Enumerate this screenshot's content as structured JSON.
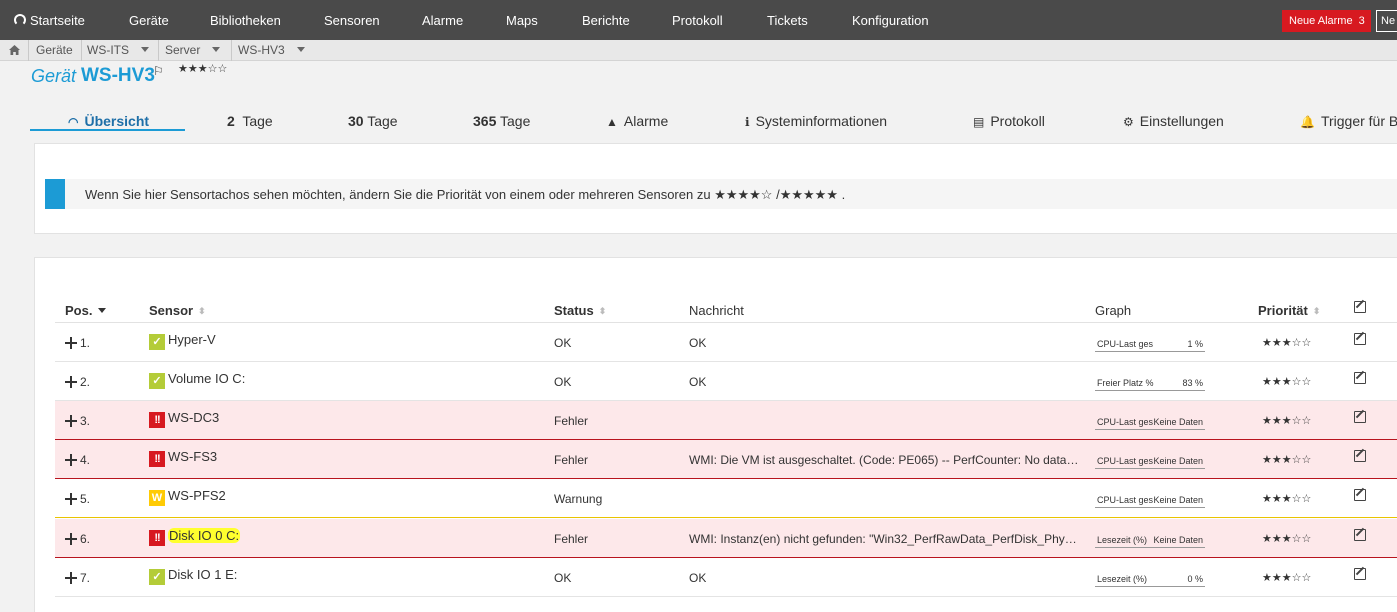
{
  "nav": {
    "home": "Startseite",
    "items": [
      "Geräte",
      "Bibliotheken",
      "Sensoren",
      "Alarme",
      "Maps",
      "Berichte",
      "Protokoll",
      "Tickets",
      "Konfiguration"
    ],
    "alarm_label": "Neue Alarme",
    "alarm_count": "3",
    "next_label": "Ne"
  },
  "breadcrumb": {
    "items": [
      "Geräte",
      "WS-ITS",
      "Server",
      "WS-HV3"
    ]
  },
  "device": {
    "label": "Gerät",
    "name": "WS-HV3",
    "flag": "⚐",
    "stars": "★★★☆☆"
  },
  "tabs": {
    "overview": "Übersicht",
    "t2_num": "2",
    "t2_label": "Tage",
    "t30_num": "30",
    "t30_label": "Tage",
    "t365_num": "365",
    "t365_label": "Tage",
    "alarms": "Alarme",
    "sysinfo": "Systeminformationen",
    "log": "Protokoll",
    "settings": "Einstellungen",
    "trigger": "Trigger für B"
  },
  "info": {
    "text": "Wenn Sie hier Sensortachos sehen möchten, ändern Sie die Priorität von einem oder mehreren Sensoren zu",
    "stars_four": "★★★★☆",
    "separator": "/",
    "stars_five": "★★★★★",
    "end": "."
  },
  "table": {
    "headers": {
      "pos": "Pos.",
      "sensor": "Sensor",
      "status": "Status",
      "message": "Nachricht",
      "graph": "Graph",
      "priority": "Priorität"
    },
    "rows": [
      {
        "pos": "1.",
        "sensor": "Hyper-V",
        "status": "OK",
        "message": "OK",
        "graph_label": "CPU-Last ges",
        "graph_value": "1 %",
        "priority": "★★★☆☆"
      },
      {
        "pos": "2.",
        "sensor": "Volume IO C:",
        "status": "OK",
        "message": "OK",
        "graph_label": "Freier Platz %",
        "graph_value": "83 %",
        "priority": "★★★☆☆"
      },
      {
        "pos": "3.",
        "sensor": "WS-DC3",
        "status": "Fehler",
        "message": "",
        "graph_label": "CPU-Last ges",
        "graph_value": "Keine Daten",
        "priority": "★★★☆☆"
      },
      {
        "pos": "4.",
        "sensor": "WS-FS3",
        "status": "Fehler",
        "message": "WMI: Die VM ist ausgeschaltet. (Code: PE065) -- PerfCounter: No data to ...",
        "graph_label": "CPU-Last ges",
        "graph_value": "Keine Daten",
        "priority": "★★★☆☆"
      },
      {
        "pos": "5.",
        "sensor": "WS-PFS2",
        "status": "Warnung",
        "message": "",
        "graph_label": "CPU-Last ges",
        "graph_value": "Keine Daten",
        "priority": "★★★☆☆"
      },
      {
        "pos": "6.",
        "sensor": "Disk IO 0 C:",
        "status": "Fehler",
        "message": "WMI: Instanz(en) nicht gefunden: \"Win32_PerfRawData_PerfDisk_Physic...",
        "graph_label": "Lesezeit (%)",
        "graph_value": "Keine Daten",
        "priority": "★★★☆☆"
      },
      {
        "pos": "7.",
        "sensor": "Disk IO 1 E:",
        "status": "OK",
        "message": "OK",
        "graph_label": "Lesezeit (%)",
        "graph_value": "0 %",
        "priority": "★★★☆☆"
      }
    ],
    "icons": {
      "ok": "✓",
      "error": "!!",
      "warning": "W"
    }
  },
  "colors": {
    "accent": "#1c9bd5",
    "nav_bg": "#4a4a4a",
    "alarm_red": "#d71920",
    "ok_green": "#b4cc38",
    "warn_yellow": "#ffcb05",
    "error_row": "#fde8ea"
  }
}
